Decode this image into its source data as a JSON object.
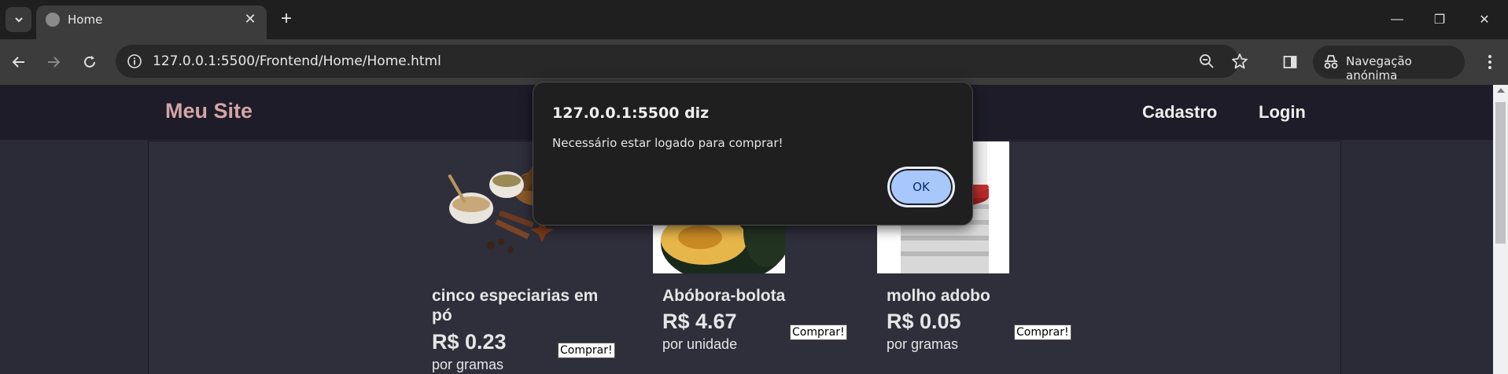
{
  "browser": {
    "tab": {
      "title": "Home"
    },
    "url": "127.0.0.1:5500/Frontend/Home/Home.html",
    "incognito_label": "Navegação anónima"
  },
  "site": {
    "brand": "Meu Site",
    "nav": {
      "cadastro": "Cadastro",
      "login": "Login"
    }
  },
  "products": [
    {
      "name": "cinco especiarias em pó",
      "price": "R$ 0.23",
      "unit": "por gramas",
      "button": "Comprar!"
    },
    {
      "name": "Abóbora-bolota",
      "price": "R$ 4.67",
      "unit": "por unidade",
      "button": "Comprar!"
    },
    {
      "name": "molho adobo",
      "price": "R$ 0.05",
      "unit": "por gramas",
      "button": "Comprar!"
    }
  ],
  "dialog": {
    "title": "127.0.0.1:5500 diz",
    "message": "Necessário estar logado para comprar!",
    "ok_label": "OK"
  },
  "colors": {
    "brand": "#d4a5a5",
    "dialog_button": "#a8c7fa"
  }
}
